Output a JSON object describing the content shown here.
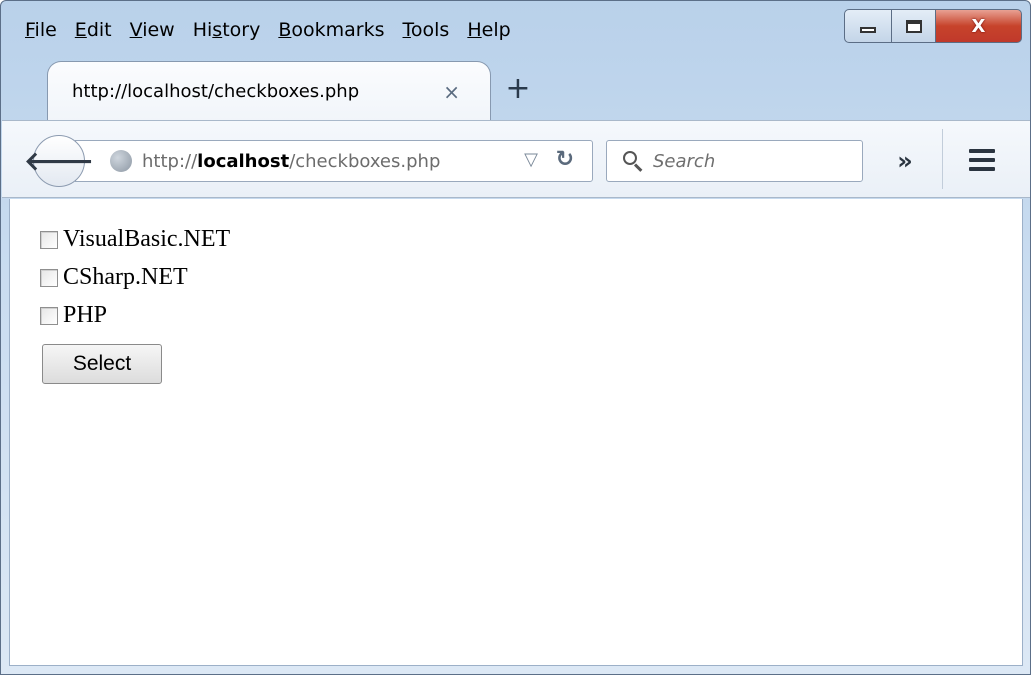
{
  "menu": {
    "items": [
      {
        "ul": "F",
        "rest": "ile"
      },
      {
        "ul": "E",
        "rest": "dit"
      },
      {
        "ul": "V",
        "rest": "iew"
      },
      {
        "pre": "Hi",
        "ul": "s",
        "rest": "tory"
      },
      {
        "ul": "B",
        "rest": "ookmarks"
      },
      {
        "ul": "T",
        "rest": "ools"
      },
      {
        "ul": "H",
        "rest": "elp"
      }
    ],
    "labels": [
      "File",
      "Edit",
      "View",
      "History",
      "Bookmarks",
      "Tools",
      "Help"
    ]
  },
  "tab": {
    "title": "http://localhost/checkboxes.php",
    "close_glyph": "×",
    "new_tab_glyph": "+"
  },
  "navbar": {
    "url_prefix": "http://",
    "url_host": "localhost",
    "url_path": "/checkboxes.php",
    "search_placeholder": "Search",
    "overflow_glyph": "»"
  },
  "page": {
    "checkboxes": [
      {
        "label": "VisualBasic.NET",
        "checked": false
      },
      {
        "label": "CSharp.NET",
        "checked": false
      },
      {
        "label": "PHP",
        "checked": false
      }
    ],
    "button_label": "Select"
  },
  "window_controls": {
    "close_glyph": "X"
  },
  "icons": {
    "back": "back-arrow-icon",
    "site": "globe-icon",
    "reload": "reload-icon",
    "search": "search-icon",
    "menu": "hamburger-icon"
  },
  "colors": {
    "close_button": "#c7432b",
    "frame": "#b9d1ea"
  }
}
